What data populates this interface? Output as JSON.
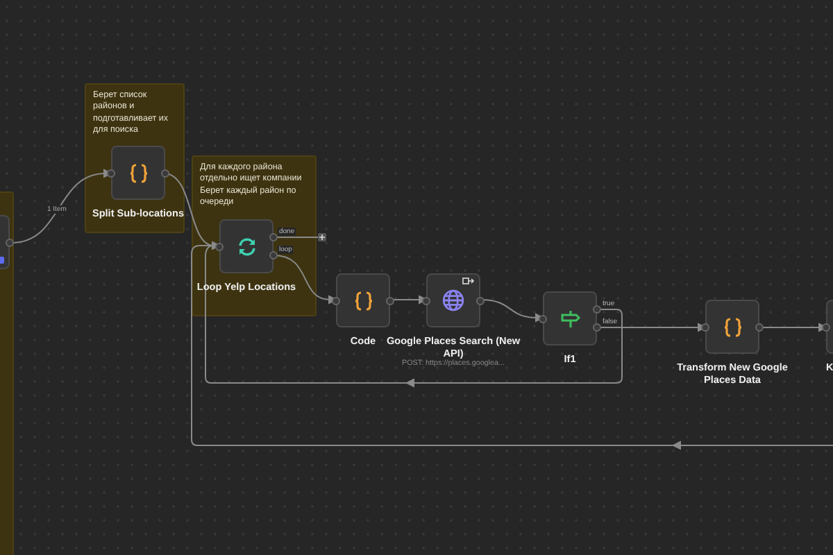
{
  "sticky_notes": [
    {
      "text": "Берет список районов и подготавливает их для поиска"
    },
    {
      "text": "Для каждого района отдельно ищет компании Берет каждый район по очереди"
    }
  ],
  "nodes": [
    {
      "kind": "trigger"
    },
    {
      "kind": "code",
      "label": "Split Sub-locations"
    },
    {
      "kind": "loop",
      "label": "Loop Yelp Locations",
      "outputs": [
        "done",
        "loop"
      ]
    },
    {
      "kind": "code",
      "label": "Code"
    },
    {
      "kind": "http",
      "label": "Google Places Search (New API)",
      "subtitle": "POST: https://places.googlea..."
    },
    {
      "kind": "if",
      "label": "If1",
      "outputs": [
        "true",
        "false"
      ]
    },
    {
      "kind": "code",
      "label": "Transform New Google Places Data"
    },
    {
      "kind": "partial",
      "label": "K"
    }
  ],
  "edge_labels": [
    "1 Item"
  ]
}
